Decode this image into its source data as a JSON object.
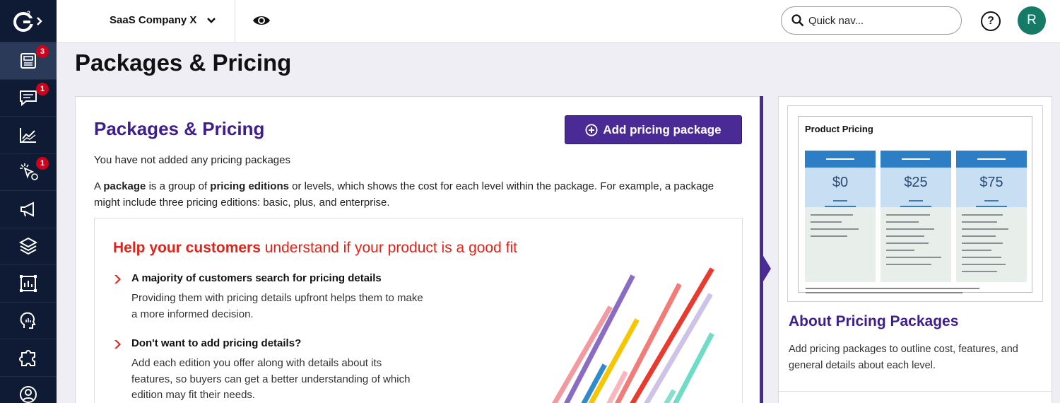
{
  "rail": {
    "logo_label": "G2",
    "items": [
      {
        "icon": "dashboard-icon",
        "badge": "3",
        "active": true
      },
      {
        "icon": "chat-icon",
        "badge": "1"
      },
      {
        "icon": "chart-icon",
        "badge": ""
      },
      {
        "icon": "click-target-icon",
        "badge": "1"
      },
      {
        "icon": "megaphone-icon",
        "badge": ""
      },
      {
        "icon": "layers-icon",
        "badge": ""
      },
      {
        "icon": "report-icon",
        "badge": ""
      },
      {
        "icon": "insights-head-icon",
        "badge": ""
      },
      {
        "icon": "puzzle-icon",
        "badge": ""
      },
      {
        "icon": "profile-icon",
        "badge": ""
      }
    ]
  },
  "header": {
    "company": "SaaS Company X",
    "quicknav_placeholder": "Quick nav...",
    "help_label": "?",
    "avatar_initial": "R"
  },
  "page": {
    "title": "Packages & Pricing"
  },
  "main": {
    "section_title": "Packages & Pricing",
    "add_button": "Add pricing package",
    "empty_message": "You have not added any pricing packages",
    "desc": {
      "t1": "A ",
      "b1": "package",
      "t2": " is a group of ",
      "b2": "pricing editions",
      "t3": " or levels, which shows the cost for each level within the package. For example, a package might include three pricing editions: basic, plus, and enterprise."
    },
    "promo": {
      "head_bold": "Help your customers",
      "head_rest": " understand if your product is a good fit",
      "points": [
        {
          "title": "A majority of customers search for pricing details",
          "body": "Providing them with pricing details upfront helps them to make a more informed decision."
        },
        {
          "title": "Don't want to add pricing details?",
          "body": "Add each edition you offer along with details about its features, so buyers can get a better understanding of which edition may fit their needs."
        }
      ]
    }
  },
  "side": {
    "preview_title": "Product Pricing",
    "tiers": [
      "$0",
      "$25",
      "$75"
    ],
    "title": "About Pricing Packages",
    "text": "Add pricing packages to outline cost, features, and general details about each level."
  },
  "colors": {
    "rail_bg": "#0f1b34",
    "brand_purple": "#4a2b95",
    "heading_purple": "#3e1d8c",
    "promo_red": "#e2231a",
    "badge_red": "#d0021b",
    "avatar_green": "#157a66",
    "tier_blue": "#2e7ec6"
  }
}
